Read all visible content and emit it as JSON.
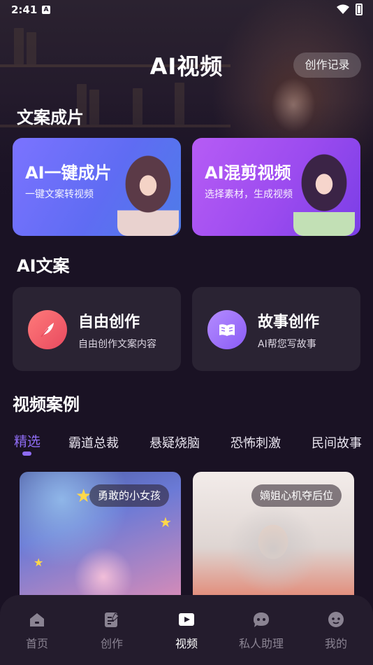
{
  "status_bar": {
    "time": "2:41",
    "notification_letter": "A"
  },
  "header": {
    "title": "AI视频",
    "record_button": "创作记录"
  },
  "sections": {
    "copy_to_film": "文案成片",
    "ai_copy": "AI文案",
    "video_cases": "视频案例"
  },
  "feature_cards": [
    {
      "title": "AI一键成片",
      "subtitle": "一键文案转视频",
      "color": "#6b6ff5"
    },
    {
      "title": "AI混剪视频",
      "subtitle": "选择素材，生成视频",
      "color": "#a453f2"
    }
  ],
  "tool_cards": [
    {
      "title": "自由创作",
      "subtitle": "自由创作文案内容",
      "icon": "feather-icon",
      "color": "#ef5b6a"
    },
    {
      "title": "故事创作",
      "subtitle": "AI帮您写故事",
      "icon": "book-icon",
      "color": "#9b6cf7"
    }
  ],
  "tabs": [
    "精选",
    "霸道总裁",
    "悬疑烧脑",
    "恐怖刺激",
    "民间故事"
  ],
  "active_tab": "精选",
  "cases": [
    {
      "label": "勇敢的小女孩"
    },
    {
      "label": "嫡姐心机夺后位"
    }
  ],
  "bottom_nav": [
    {
      "label": "首页",
      "icon": "home-icon"
    },
    {
      "label": "创作",
      "icon": "edit-icon"
    },
    {
      "label": "视频",
      "icon": "video-play-icon"
    },
    {
      "label": "私人助理",
      "icon": "chat-bubble-icon"
    },
    {
      "label": "我的",
      "icon": "profile-icon"
    }
  ],
  "active_nav": "视频",
  "accent_color": "#8f6cf5"
}
